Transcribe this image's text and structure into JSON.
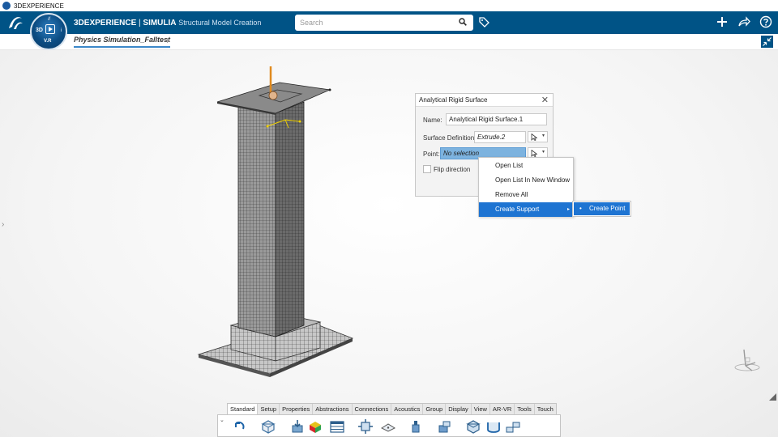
{
  "window": {
    "title": "3DEXPERIENCE"
  },
  "header": {
    "brand": "3DEXPERIENCE",
    "separator": " | ",
    "product": "SIMULIA",
    "app": "Structural Model Creation",
    "search_placeholder": "Search",
    "compass": {
      "label_3d": "3D",
      "version": "V.R",
      "top": "//",
      "info": "i"
    }
  },
  "tabs": {
    "active": "Physics Simulation_Falltest",
    "add": "+"
  },
  "dialog": {
    "title": "Analytical Rigid Surface",
    "close": "✕",
    "name_label": "Name:",
    "name_value": "Analytical Rigid Surface.1",
    "surface_label": "Surface Definition",
    "surface_value": "Extrude.2",
    "point_label": "Point:",
    "point_value": "No selection",
    "flip_label": "Flip direction",
    "dropdown": "▾"
  },
  "context_menu": {
    "items": [
      "Open List",
      "Open List In New Window",
      "Remove All",
      "Create Support"
    ],
    "submenu_arrow": "▸",
    "submenu": [
      "Create Point"
    ]
  },
  "ribbon": {
    "tabs": [
      "Standard",
      "Setup",
      "Properties",
      "Abstractions",
      "Connections",
      "Acoustics",
      "Group",
      "Display",
      "View",
      "AR-VR",
      "Tools",
      "Touch"
    ],
    "active_tab": "Standard",
    "collapse": "⌄"
  },
  "misc": {
    "left_arrow": "›"
  },
  "colors": {
    "header_bg": "#005386",
    "selection_blue": "#1e74d2",
    "field_selected": "#7db3df",
    "model_grey": "#8c8c8c"
  }
}
